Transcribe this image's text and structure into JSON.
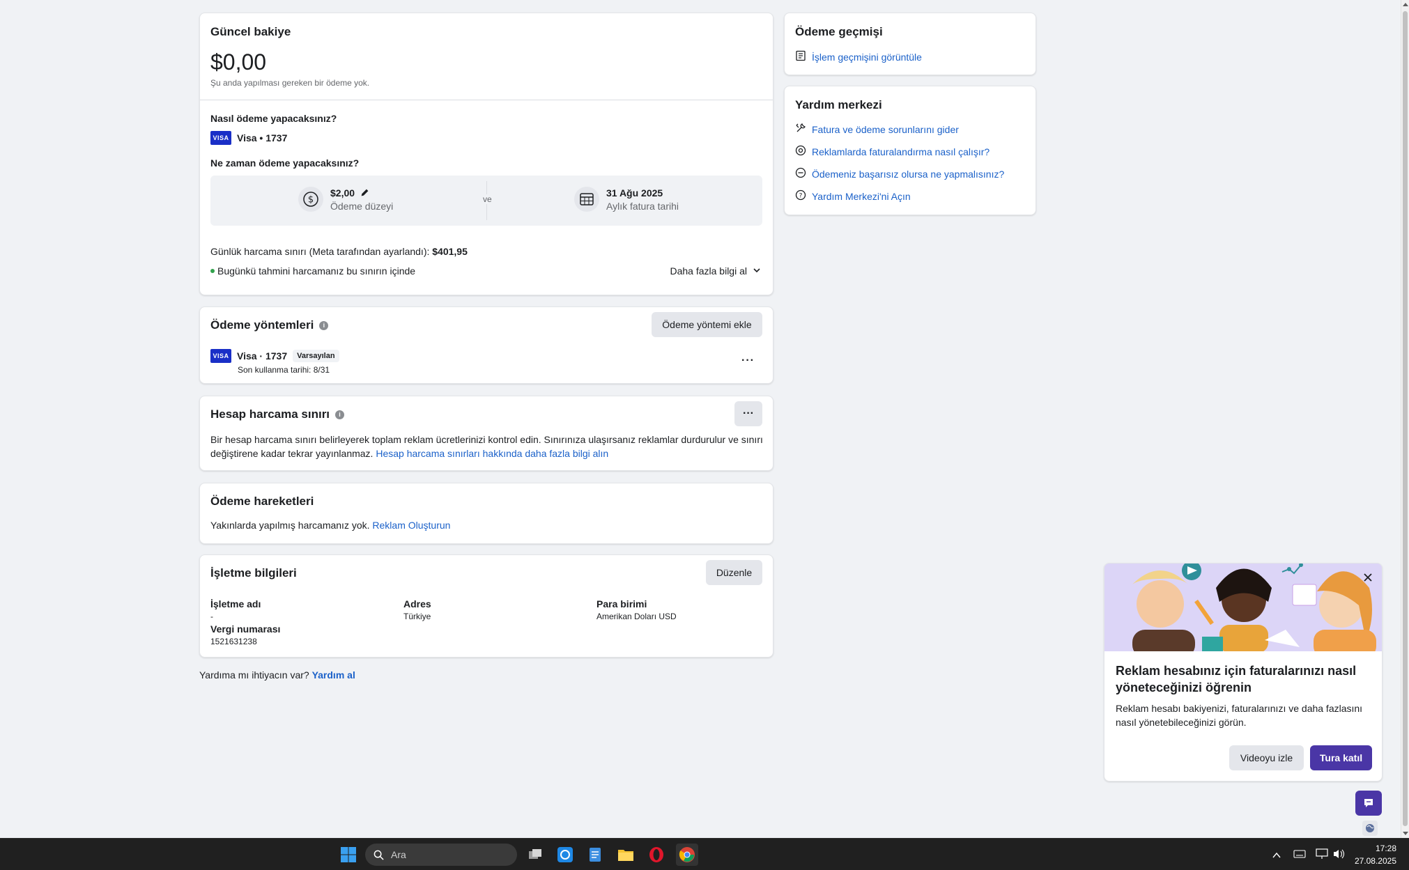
{
  "balance": {
    "title": "Güncel bakiye",
    "amount": "$0,00",
    "note": "Şu anda yapılması gereken bir ödeme yok.",
    "how_title": "Nasıl ödeme yapacaksınız?",
    "card_label": "Visa • 1737",
    "card_brand": "VISA",
    "when_title": "Ne zaman ödeme yapacaksınız?",
    "threshold_value": "$2,00",
    "threshold_label": "Ödeme düzeyi",
    "and_label": "ve",
    "date_value": "31 Ağu 2025",
    "date_label": "Aylık fatura tarihi",
    "daily_limit_text": "Günlük harcama sınırı (Meta tarafından ayarlandı):",
    "daily_limit_value": "$401,95",
    "status_text": "Bugünkü tahmini harcamanız bu sınırın içinde",
    "learn_more": "Daha fazla bilgi al"
  },
  "payment_methods": {
    "title": "Ödeme yöntemleri",
    "add_button": "Ödeme yöntemi ekle",
    "card_brand": "VISA",
    "card_label": "Visa · 1737",
    "default_badge": "Varsayılan",
    "expiry": "Son kullanma tarihi: 8/31"
  },
  "spending_limit": {
    "title": "Hesap harcama sınırı",
    "description": "Bir hesap harcama sınırı belirleyerek toplam reklam ücretlerinizi kontrol edin. Sınırınıza ulaşırsanız reklamlar durdurulur ve sınırı değiştirene kadar tekrar yayınlanmaz.",
    "link": "Hesap harcama sınırları hakkında daha fazla bilgi alın"
  },
  "activity": {
    "title": "Ödeme hareketleri",
    "text": "Yakınlarda yapılmış harcamanız yok.",
    "link": "Reklam Oluşturun"
  },
  "business": {
    "title": "İşletme bilgileri",
    "edit_button": "Düzenle",
    "name_label": "İşletme adı",
    "name_value": "-",
    "address_label": "Adres",
    "address_value": "Türkiye",
    "currency_label": "Para birimi",
    "currency_value": "Amerikan Doları USD",
    "tax_label": "Vergi numarası",
    "tax_value": "1521631238"
  },
  "help_footer": {
    "question": "Yardıma mı ihtiyacın var?",
    "link": "Yardım al"
  },
  "history": {
    "title": "Ödeme geçmişi",
    "link": "İşlem geçmişini görüntüle"
  },
  "help_center": {
    "title": "Yardım merkezi",
    "links": [
      "Fatura ve ödeme sorunlarını gider",
      "Reklamlarda faturalandırma nasıl çalışır?",
      "Ödemeniz başarısız olursa ne yapmalısınız?",
      "Yardım Merkezi'ni Açın"
    ]
  },
  "tour_popup": {
    "title": "Reklam hesabınız için faturalarınızı nasıl yöneteceğinizi öğrenin",
    "text": "Reklam hesabı bakiyenizi, faturalarınızı ve daha fazlasını nasıl yönetebileceğinizi görün.",
    "video_button": "Videoyu izle",
    "tour_button": "Tura katıl"
  },
  "taskbar": {
    "search_placeholder": "Ara",
    "time": "17:28",
    "date": "27.08.2025"
  },
  "colors": {
    "link": "#1b61c9",
    "primary_button": "#4a36a6",
    "visa_blue": "#1a2fc7",
    "status_green": "#31a24c"
  }
}
